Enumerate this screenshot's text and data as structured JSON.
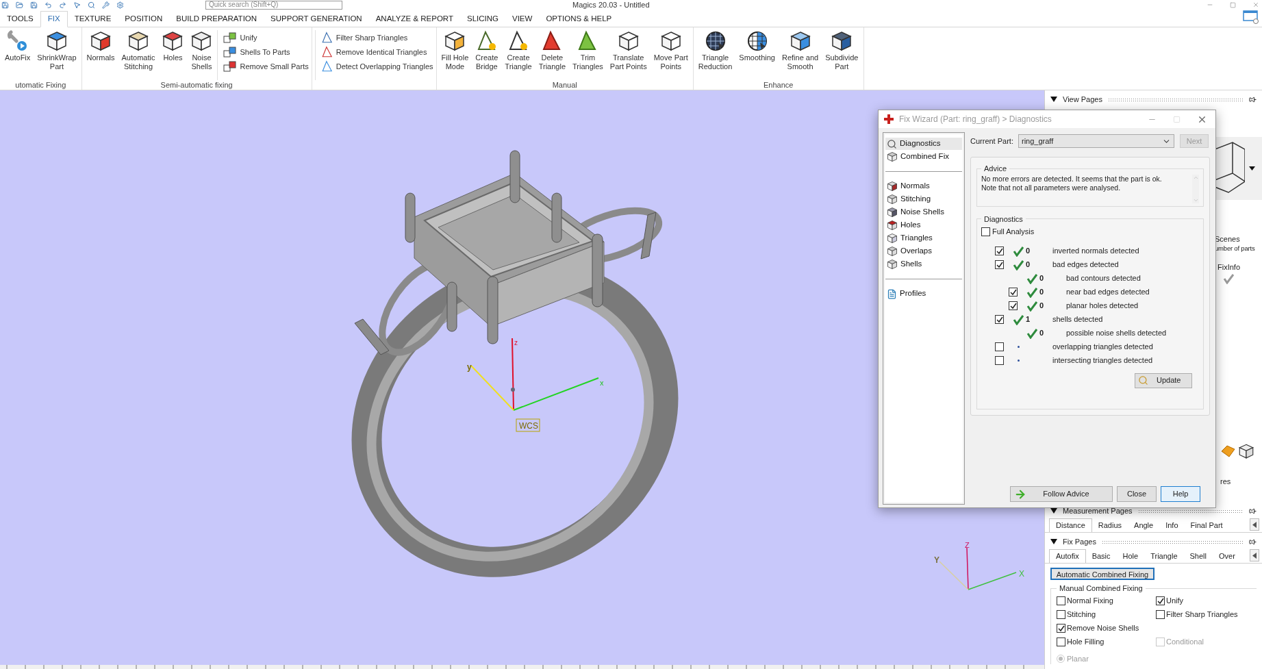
{
  "title_bar": {
    "title": "Magics 20.03 - Untitled",
    "search": {
      "placeholder": "Quick search (Shift+Q)"
    }
  },
  "ribbon_tabs": [
    {
      "label": "TOOLS",
      "selected": false
    },
    {
      "label": "FIX",
      "selected": true
    },
    {
      "label": "TEXTURE",
      "selected": false
    },
    {
      "label": "POSITION",
      "selected": false
    },
    {
      "label": "BUILD PREPARATION",
      "selected": false
    },
    {
      "label": "SUPPORT GENERATION",
      "selected": false
    },
    {
      "label": "ANALYZE & REPORT",
      "selected": false
    },
    {
      "label": "SLICING",
      "selected": false
    },
    {
      "label": "VIEW",
      "selected": false
    },
    {
      "label": "OPTIONS & HELP",
      "selected": false
    }
  ],
  "ribbon_groups": [
    {
      "label": "utomatic Fixing",
      "items": [
        {
          "kind": "large",
          "label": "AutoFix"
        },
        {
          "kind": "large",
          "label": "ShrinkWrap\nPart"
        }
      ]
    },
    {
      "label": "Semi-automatic fixing",
      "items": [
        {
          "kind": "large",
          "label": "Normals"
        },
        {
          "kind": "large",
          "label": "Automatic\nStitching"
        },
        {
          "kind": "large",
          "label": "Holes"
        },
        {
          "kind": "large",
          "label": "Noise\nShells"
        },
        {
          "kind": "stack",
          "labels": [
            "Unify",
            "Shells To Parts",
            "Remove Small Parts"
          ]
        }
      ]
    },
    {
      "items": [
        {
          "kind": "stack",
          "labels": [
            "Filter Sharp Triangles",
            "Remove Identical Triangles",
            "Detect Overlapping Triangles"
          ]
        }
      ]
    },
    {
      "label": "Manual",
      "items": [
        {
          "kind": "large",
          "label": "Fill Hole\nMode"
        },
        {
          "kind": "large",
          "label": "Create\nBridge"
        },
        {
          "kind": "large",
          "label": "Create\nTriangle"
        },
        {
          "kind": "large",
          "label": "Delete\nTriangle"
        },
        {
          "kind": "large",
          "label": "Trim\nTriangles"
        },
        {
          "kind": "large",
          "label": "Translate\nPart Points"
        },
        {
          "kind": "large",
          "label": "Move Part\nPoints"
        }
      ]
    },
    {
      "label": "Enhance",
      "items": [
        {
          "kind": "large",
          "label": "Triangle\nReduction"
        },
        {
          "kind": "large",
          "label": "Smoothing"
        },
        {
          "kind": "large",
          "label": "Refine and\nSmooth"
        },
        {
          "kind": "large",
          "label": "Subdivide\nPart"
        }
      ]
    }
  ],
  "viewport": {
    "axis_labels": [
      "z",
      "y",
      "x"
    ],
    "frame_label": "WCS",
    "triad_labels": [
      "Z",
      "Y",
      "X"
    ]
  },
  "dialog": {
    "title": "Fix Wizard (Part: ring_graff) > Diagnostics",
    "nav_sections": [
      [
        {
          "label": "Diagnostics",
          "selected": true
        },
        {
          "label": "Combined Fix",
          "selected": false
        }
      ],
      [
        {
          "label": "Normals",
          "selected": false
        },
        {
          "label": "Stitching",
          "selected": false
        },
        {
          "label": "Noise Shells",
          "selected": false
        },
        {
          "label": "Holes",
          "selected": false
        },
        {
          "label": "Triangles",
          "selected": false
        },
        {
          "label": "Overlaps",
          "selected": false
        },
        {
          "label": "Shells",
          "selected": false
        }
      ],
      [
        {
          "label": "Profiles",
          "selected": false
        }
      ]
    ],
    "current_part": {
      "label": "Current Part:",
      "value": "ring_graff"
    },
    "next_button": {
      "label": "Next",
      "disabled": true
    },
    "advice": {
      "legend": "Advice",
      "text": "No more errors are detected. It seems that the part is ok.\nNote that not all parameters were analysed."
    },
    "diagnostics": {
      "legend": "Diagnostics",
      "full_analysis": {
        "label": "Full Analysis",
        "checked": false
      },
      "rows": [
        {
          "kind": "check",
          "checked": true,
          "passed": true,
          "count": "0",
          "label": "inverted normals detected"
        },
        {
          "kind": "check",
          "checked": true,
          "passed": true,
          "count": "0",
          "label": "bad edges detected",
          "children": [
            {
              "kind": "info",
              "passed": true,
              "count": "0",
              "label": "bad contours detected"
            },
            {
              "kind": "check",
              "checked": true,
              "passed": true,
              "count": "0",
              "label": "near bad edges detected"
            },
            {
              "kind": "check",
              "checked": true,
              "passed": true,
              "count": "0",
              "label": "planar holes detected"
            }
          ]
        },
        {
          "kind": "check",
          "checked": true,
          "passed": true,
          "count": "1",
          "label": "shells detected",
          "children": [
            {
              "kind": "info",
              "passed": true,
              "count": "0",
              "label": "possible noise shells detected"
            }
          ]
        },
        {
          "kind": "check",
          "checked": false,
          "passed": false,
          "label": "overlapping triangles detected"
        },
        {
          "kind": "check",
          "checked": false,
          "passed": false,
          "label": "intersecting triangles detected"
        }
      ]
    },
    "update_button": "Update",
    "buttons": [
      {
        "label": "Follow Advice",
        "focused": false
      },
      {
        "label": "Close",
        "focused": false
      },
      {
        "label": "Help",
        "focused": true
      }
    ]
  },
  "right_panel": {
    "view_pages": {
      "title": "View Pages"
    },
    "strip": {
      "texts": [
        "Scenes",
        "umber of parts"
      ],
      "column": "FixInfo",
      "fixinfo_ok": true,
      "tail": "res"
    },
    "measurement_pages": {
      "title": "Measurement Pages",
      "tabs": [
        {
          "label": "Distance",
          "selected": true
        },
        {
          "label": "Radius",
          "selected": false
        },
        {
          "label": "Angle",
          "selected": false
        },
        {
          "label": "Info",
          "selected": false
        },
        {
          "label": "Final Part",
          "selected": false
        }
      ]
    },
    "fix_pages": {
      "title": "Fix Pages",
      "tabs": [
        {
          "label": "Autofix",
          "selected": true
        },
        {
          "label": "Basic",
          "selected": false
        },
        {
          "label": "Hole",
          "selected": false
        },
        {
          "label": "Triangle",
          "selected": false
        },
        {
          "label": "Shell",
          "selected": false
        },
        {
          "label": "Over",
          "selected": false
        }
      ],
      "auto_button": "Automatic Combined Fixing",
      "manual_group": {
        "legend": "Manual Combined Fixing",
        "rows": [
          [
            {
              "label": "Normal Fixing",
              "checked": false,
              "disabled": false
            },
            {
              "label": "Unify",
              "checked": true,
              "disabled": false
            }
          ],
          [
            {
              "label": "Stitching",
              "checked": false,
              "disabled": false
            },
            {
              "label": "Filter Sharp Triangles",
              "checked": false,
              "disabled": false
            }
          ],
          [
            {
              "label": "Remove Noise Shells",
              "checked": true,
              "disabled": false
            }
          ],
          [
            {
              "label": "Hole Filling",
              "checked": false,
              "disabled": false
            },
            {
              "label": "Conditional",
              "checked": false,
              "disabled": true
            }
          ]
        ]
      },
      "radio": {
        "label": "Planar",
        "selected": true,
        "disabled": true
      }
    }
  }
}
